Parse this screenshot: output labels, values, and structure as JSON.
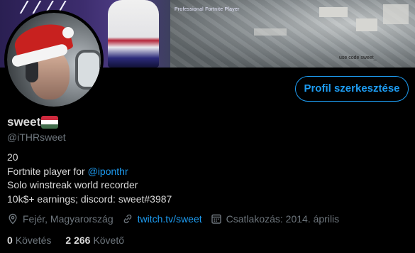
{
  "banner": {
    "subtitle": "Professional Fortnite Player",
    "code_text": "use code sweet_"
  },
  "profile": {
    "name": "sweet",
    "handle": "@iTHRsweet",
    "edit_button": "Profil szerkesztése",
    "flag_colors": [
      "#cd2a3e",
      "#ffffff",
      "#436f4d"
    ]
  },
  "bio": {
    "line1": "20",
    "line2_prefix": "Fortnite player for ",
    "line2_mention": "@iponthr",
    "line3": "Solo winstreak world recorder",
    "line4": "10k$+ earnings; discord: sweet#3987"
  },
  "meta": {
    "location": "Fejér, Magyarország",
    "website": "twitch.tv/sweet",
    "joined": "Csatlakozás: 2014. április"
  },
  "stats": {
    "following_count": "0",
    "following_label": "Követés",
    "followers_count": "2 266",
    "followers_label": "Követő"
  },
  "colors": {
    "accent": "#1d9bf0",
    "muted": "#6e767d",
    "text": "#d9d9d9",
    "background": "#000000"
  }
}
